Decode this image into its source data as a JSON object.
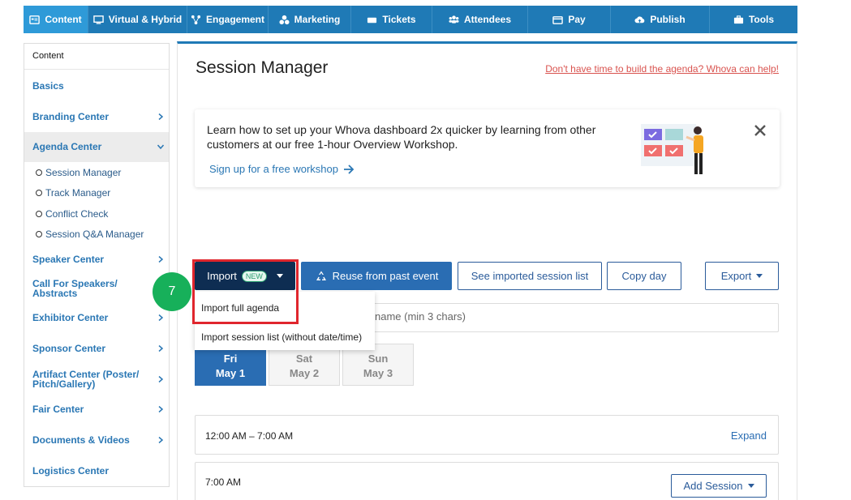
{
  "nav": {
    "tabs": [
      {
        "label": "Content",
        "icon": "content-icon"
      },
      {
        "label": "Virtual & Hybrid",
        "icon": "monitor-icon"
      },
      {
        "label": "Engagement",
        "icon": "engagement-icon"
      },
      {
        "label": "Marketing",
        "icon": "marketing-icon"
      },
      {
        "label": "Tickets",
        "icon": "ticket-icon"
      },
      {
        "label": "Attendees",
        "icon": "attendees-icon"
      },
      {
        "label": "Pay",
        "icon": "card-icon"
      },
      {
        "label": "Publish",
        "icon": "cloud-upload-icon"
      },
      {
        "label": "Tools",
        "icon": "toolbox-icon"
      }
    ]
  },
  "sidebar": {
    "heading": "Content",
    "items": [
      {
        "label": "Basics"
      },
      {
        "label": "Branding Center"
      },
      {
        "label": "Agenda Center"
      },
      {
        "label": "Speaker Center"
      },
      {
        "label": "Call For Speakers/ Abstracts"
      },
      {
        "label": "Exhibitor Center"
      },
      {
        "label": "Sponsor Center"
      },
      {
        "label": "Artifact Center (Poster/ Pitch/Gallery)"
      },
      {
        "label": "Fair Center"
      },
      {
        "label": "Documents & Videos"
      },
      {
        "label": "Logistics Center"
      }
    ],
    "agenda_sub": [
      {
        "label": "Session Manager"
      },
      {
        "label": "Track Manager"
      },
      {
        "label": "Conflict Check"
      },
      {
        "label": "Session Q&A Manager"
      }
    ]
  },
  "page": {
    "title": "Session Manager",
    "help_link": "Don't have time to build the agenda? Whova can help!"
  },
  "banner": {
    "message": "Learn how to set up your Whova dashboard 2x quicker by learning from other customers at our free 1-hour Overview Workshop.",
    "signup": "Sign up for a free workshop"
  },
  "toolbar": {
    "import": "Import",
    "new_badge": "NEW",
    "reuse": "Reuse from past event",
    "see_imported": "See imported session list",
    "copy_day": "Copy day",
    "export": "Export"
  },
  "import_menu": {
    "options": [
      "Import full agenda",
      "Import session list (without date/time)"
    ]
  },
  "step_marker": "7",
  "search": {
    "placeholder": "Search by session name or speaker name (min 3 chars)"
  },
  "days": [
    {
      "weekday": "Fri",
      "date": "May 1"
    },
    {
      "weekday": "Sat",
      "date": "May 2"
    },
    {
      "weekday": "Sun",
      "date": "May 3"
    }
  ],
  "slots": [
    {
      "time": "12:00 AM – 7:00 AM",
      "action": "Expand"
    },
    {
      "time": "7:00 AM",
      "action": "Add Session"
    }
  ],
  "colors": {
    "nav_bg": "#1f7ab6",
    "nav_active": "#2e9ad8",
    "import_btn": "#0e2d52",
    "primary_btn": "#2a6db3",
    "highlight": "#e0262d",
    "step_marker": "#17b05a"
  }
}
